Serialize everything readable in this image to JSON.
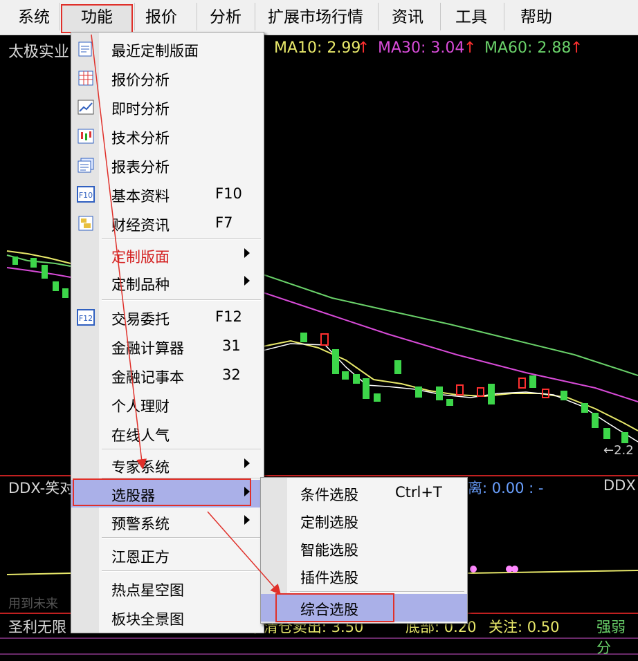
{
  "menubar": {
    "items": [
      "系统",
      "功能",
      "报价",
      "分析",
      "扩展市场行情",
      "资讯",
      "工具",
      "帮助"
    ],
    "active": "功能"
  },
  "chart": {
    "stock_name": "太极实业",
    "ma10": "MA10: 2.99",
    "ma30": "MA30: 3.04",
    "ma60": "MA60: 2.88",
    "ma_arrow": "↑",
    "price_tag": "←2.2",
    "ddx_left": "DDX-笑对",
    "ddx_mid": "离: 0.00 : -",
    "ddx_right": "DDX",
    "faded_text": "用到未来",
    "bottom_left": "圣利无限",
    "bottom_stats": [
      ") 清仓卖出: 3.50",
      "底部: 0.20",
      "关注: 0.50",
      "强弱分"
    ],
    "colors": {
      "ma10": "#e8e86a",
      "ma30": "#d84bd8",
      "ma60": "#6ad26a",
      "up": "#ff3030"
    }
  },
  "dropdown": {
    "items": [
      {
        "label": "最近定制版面",
        "icon": "recent-layout-icon"
      },
      {
        "label": "报价分析",
        "icon": "quote-analysis-icon"
      },
      {
        "label": "即时分析",
        "icon": "realtime-analysis-icon"
      },
      {
        "label": "技术分析",
        "icon": "technical-analysis-icon"
      },
      {
        "label": "报表分析",
        "icon": "report-analysis-icon"
      },
      {
        "label": "基本资料",
        "icon": "f10-icon",
        "shortcut": "F10"
      },
      {
        "label": "财经资讯",
        "icon": "finance-news-icon",
        "shortcut": "F7"
      },
      {
        "label": "定制版面",
        "submenu": true
      },
      {
        "label": "定制品种",
        "submenu": true
      },
      {
        "label": "交易委托",
        "icon": "f12-icon",
        "shortcut": "F12"
      },
      {
        "label": "金融计算器",
        "shortcut": "31"
      },
      {
        "label": "金融记事本",
        "shortcut": "32"
      },
      {
        "label": "个人理财"
      },
      {
        "label": "在线人气"
      },
      {
        "label": "专家系统",
        "submenu": true
      },
      {
        "label": "选股器",
        "submenu": true
      },
      {
        "label": "预警系统",
        "submenu": true
      },
      {
        "label": "江恩正方"
      },
      {
        "label": "热点星空图"
      },
      {
        "label": "板块全景图"
      }
    ],
    "f10_text": "F10",
    "f12_text": "F12"
  },
  "submenu": {
    "items": [
      {
        "label": "条件选股",
        "shortcut": "Ctrl+T"
      },
      {
        "label": "定制选股"
      },
      {
        "label": "智能选股"
      },
      {
        "label": "插件选股"
      },
      {
        "label": "综合选股"
      }
    ]
  }
}
